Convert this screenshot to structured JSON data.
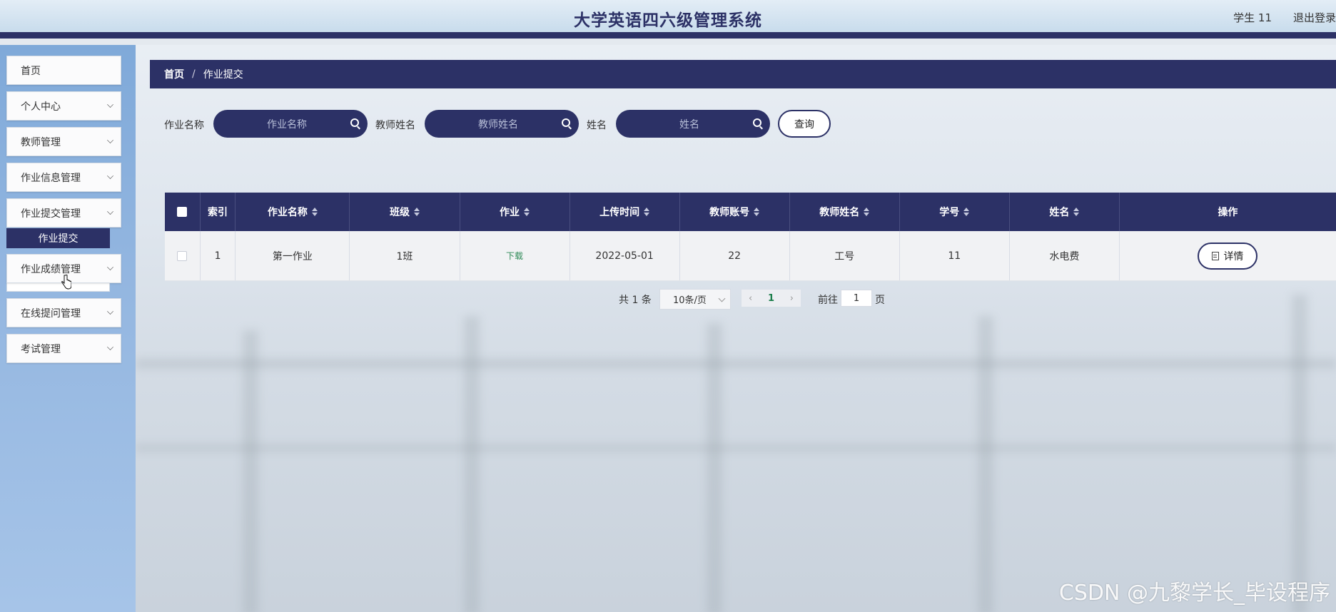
{
  "header": {
    "title": "大学英语四六级管理系统",
    "user_label": "学生 11",
    "logout_label": "退出登录"
  },
  "sidebar": {
    "items": [
      {
        "label": "首页",
        "has_arrow": false
      },
      {
        "label": "个人中心",
        "has_arrow": true
      },
      {
        "label": "教师管理",
        "has_arrow": true
      },
      {
        "label": "作业信息管理",
        "has_arrow": true
      },
      {
        "label": "作业提交管理",
        "has_arrow": true,
        "expanded": true
      },
      {
        "label": "作业成绩管理",
        "has_arrow": true
      },
      {
        "label": "在线提问管理",
        "has_arrow": true
      },
      {
        "label": "考试管理",
        "has_arrow": true
      }
    ],
    "sub_item": "作业提交"
  },
  "breadcrumb": {
    "home": "首页",
    "separator": "/",
    "current": "作业提交"
  },
  "search": {
    "field1_label": "作业名称",
    "field1_placeholder": "作业名称",
    "field2_label": "教师姓名",
    "field2_placeholder": "教师姓名",
    "field3_label": "姓名",
    "field3_placeholder": "姓名",
    "query_label": "查询"
  },
  "table": {
    "columns": [
      "索引",
      "作业名称",
      "班级",
      "作业",
      "上传时间",
      "教师账号",
      "教师姓名",
      "学号",
      "姓名",
      "操作"
    ],
    "rows": [
      {
        "index": "1",
        "homework_name": "第一作业",
        "class": "1班",
        "homework": "下载",
        "upload_time": "2022-05-01",
        "teacher_account": "22",
        "teacher_name": "工号",
        "student_id": "11",
        "name": "水电费",
        "action": "详情"
      }
    ]
  },
  "pagination": {
    "total": "共 1 条",
    "page_size": "10条/页",
    "prev": "‹",
    "current_page": "1",
    "next": "›",
    "goto_label": "前往",
    "goto_value": "1",
    "page_suffix": "页"
  },
  "watermark": "CSDN @九黎学长_毕设程序",
  "colors": {
    "primary": "#2c3166",
    "download": "#2e8a57",
    "sidebar": "#93b6e0"
  }
}
